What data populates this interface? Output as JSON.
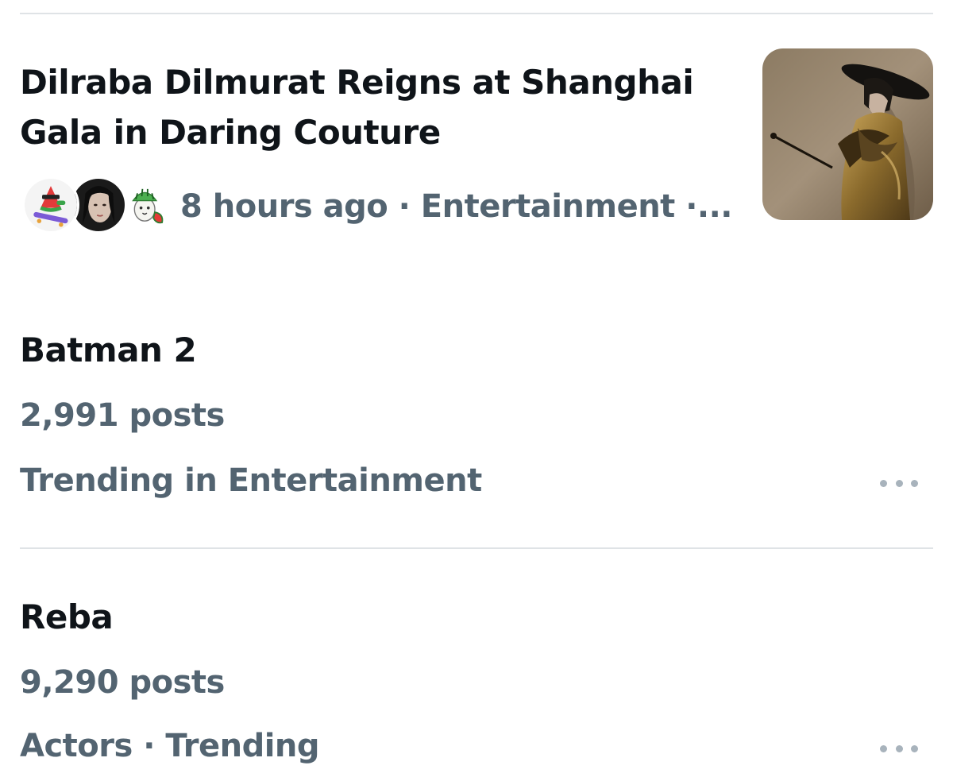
{
  "news": {
    "title": "Dilraba Dilmurat Reigns at Shanghai Gala in Daring Couture",
    "meta": "8 hours ago · Entertainment ·...",
    "avatars": [
      "watermelon-skateboard-avatar",
      "person-portrait-avatar",
      "watermelon-cartoon-avatar"
    ],
    "thumbnail": "gala-photo-thumbnail"
  },
  "trends": [
    {
      "name": "Batman 2",
      "posts": "2,991 posts",
      "context": "Trending in Entertainment",
      "more_icon": "more-horizontal-icon"
    },
    {
      "name": "Reba",
      "posts": "9,290 posts",
      "context": "Actors · Trending",
      "more_icon": "more-horizontal-icon"
    }
  ],
  "colors": {
    "primary_text": "#0f1419",
    "secondary_text": "#536471",
    "divider": "#dfe3e6",
    "more_dots": "#a8b3bc"
  }
}
